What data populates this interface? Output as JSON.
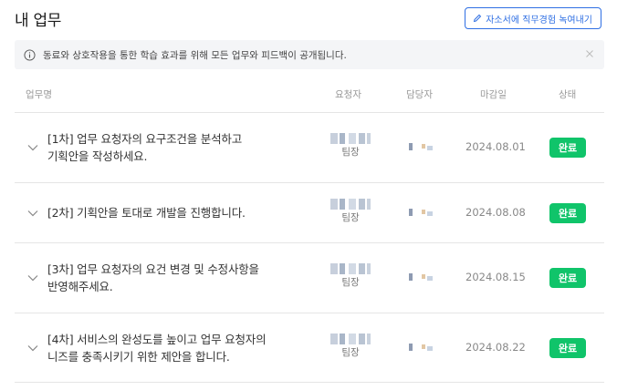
{
  "header": {
    "title": "내 업무",
    "resume_button": "자소서에 직무경험 녹여내기",
    "resume_icon": "pencil-icon"
  },
  "notice": {
    "text": "동료와 상호작용을 통한 학습 효과를 위해 모든 업무와 피드백이 공개됩니다.",
    "icon": "info-icon",
    "close_icon": "close-icon"
  },
  "table": {
    "columns": [
      "업무명",
      "요청자",
      "담당자",
      "마감일",
      "상태"
    ],
    "rows": [
      {
        "task_line1": "[1차] 업무 요청자의 요구조건을 분석하고",
        "task_line2": "기획안을 작성하세요.",
        "requester_rank": "팀장",
        "due": "2024.08.01",
        "status": "완료"
      },
      {
        "task_line1": "[2차] 기획안을 토대로 개발을 진행합니다.",
        "task_line2": "",
        "requester_rank": "팀장",
        "due": "2024.08.08",
        "status": "완료"
      },
      {
        "task_line1": "[3차] 업무 요청자의 요건 변경 및 수정사항을",
        "task_line2": "반영해주세요.",
        "requester_rank": "팀장",
        "due": "2024.08.15",
        "status": "완료"
      },
      {
        "task_line1": "[4차] 서비스의 완성도를 높이고 업무 요청자의",
        "task_line2": "니즈를 충족시키기 위한 제안을 합니다.",
        "requester_rank": "팀장",
        "due": "2024.08.22",
        "status": "완료"
      }
    ]
  },
  "colors": {
    "accent": "#2f6fe3",
    "status_done": "#10c46a",
    "notice_bg": "#f4f5f7"
  }
}
